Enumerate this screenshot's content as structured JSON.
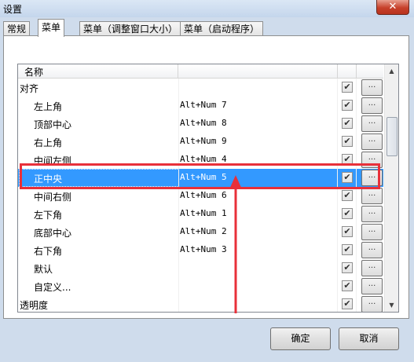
{
  "window": {
    "title": "设置",
    "close_glyph": "✕"
  },
  "tabs": [
    {
      "label": "常规"
    },
    {
      "label": "菜单"
    },
    {
      "label": "菜单（调整窗口大小）"
    },
    {
      "label": "菜单（启动程序）"
    }
  ],
  "active_tab_index": 1,
  "list": {
    "header": {
      "name": "名称"
    },
    "rows": [
      {
        "name": "对齐",
        "shortcut": "",
        "indent": 0,
        "checked": true
      },
      {
        "name": "左上角",
        "shortcut": "Alt+Num 7",
        "indent": 1,
        "checked": true
      },
      {
        "name": "顶部中心",
        "shortcut": "Alt+Num 8",
        "indent": 1,
        "checked": true
      },
      {
        "name": "右上角",
        "shortcut": "Alt+Num 9",
        "indent": 1,
        "checked": true
      },
      {
        "name": "中间左侧",
        "shortcut": "Alt+Num 4",
        "indent": 1,
        "checked": true
      },
      {
        "name": "正中央",
        "shortcut": "Alt+Num 5",
        "indent": 1,
        "checked": true,
        "selected": true
      },
      {
        "name": "中间右侧",
        "shortcut": "Alt+Num 6",
        "indent": 1,
        "checked": true
      },
      {
        "name": "左下角",
        "shortcut": "Alt+Num 1",
        "indent": 1,
        "checked": true
      },
      {
        "name": "底部中心",
        "shortcut": "Alt+Num 2",
        "indent": 1,
        "checked": true
      },
      {
        "name": "右下角",
        "shortcut": "Alt+Num 3",
        "indent": 1,
        "checked": true
      },
      {
        "name": "默认",
        "shortcut": "",
        "indent": 1,
        "checked": true
      },
      {
        "name": "自定义...",
        "shortcut": "",
        "indent": 1,
        "checked": true
      },
      {
        "name": "透明度",
        "shortcut": "",
        "indent": 0,
        "checked": true
      }
    ],
    "browse_label": "...",
    "check_glyph": "✔"
  },
  "buttons": {
    "ok": "确定",
    "cancel": "取消"
  },
  "colors": {
    "selection": "#3399ff",
    "annotation": "#e8303a"
  }
}
